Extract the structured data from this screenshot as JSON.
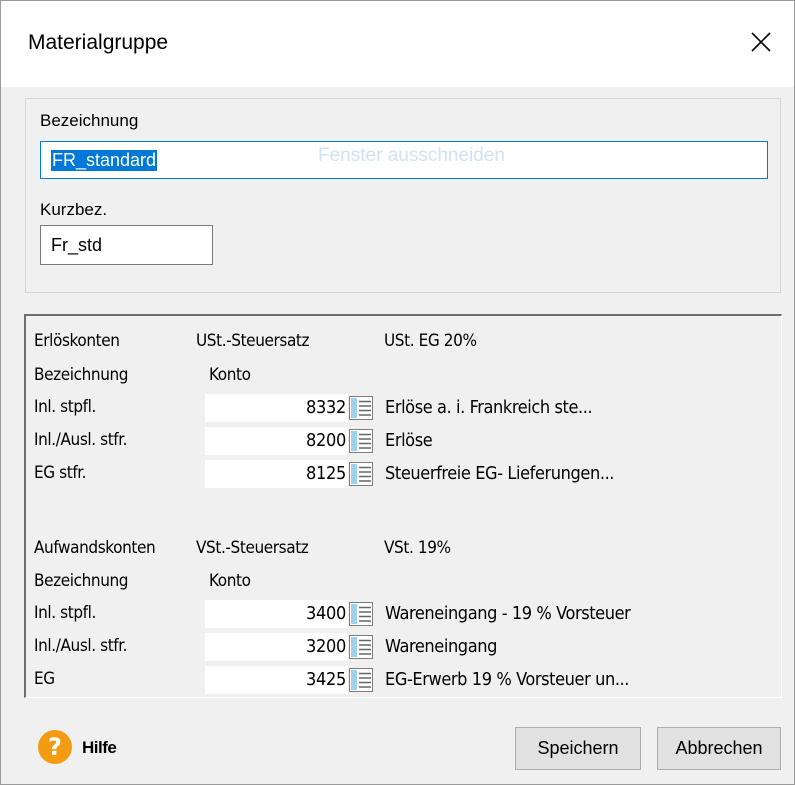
{
  "dialog": {
    "title": "Materialgruppe"
  },
  "fields": {
    "bezeichnung_label": "Bezeichnung",
    "bezeichnung_value": "FR_standard",
    "kurzbez_label": "Kurzbez.",
    "kurzbez_value": "Fr_std",
    "ghost_text": "Fenster ausschneiden"
  },
  "erloes": {
    "header": "Erlöskonten",
    "tax_label": "USt.-Steuersatz",
    "tax_value": "USt. EG 20%",
    "col_bezeichnung": "Bezeichnung",
    "col_konto": "Konto",
    "rows": [
      {
        "label": "Inl. stpfl.",
        "konto": "8332",
        "desc": "Erlöse a. i. Frankreich ste..."
      },
      {
        "label": "Inl./Ausl. stfr.",
        "konto": "8200",
        "desc": "Erlöse"
      },
      {
        "label": "EG stfr.",
        "konto": "8125",
        "desc": "Steuerfreie EG- Lieferungen..."
      }
    ]
  },
  "aufwand": {
    "header": "Aufwandskonten",
    "tax_label": "VSt.-Steuersatz",
    "tax_value": "VSt. 19%",
    "col_bezeichnung": "Bezeichnung",
    "col_konto": "Konto",
    "rows": [
      {
        "label": "Inl. stpfl.",
        "konto": "3400",
        "desc": "Wareneingang - 19 % Vorsteuer"
      },
      {
        "label": "Inl./Ausl. stfr.",
        "konto": "3200",
        "desc": "Wareneingang"
      },
      {
        "label": "EG",
        "konto": "3425",
        "desc": "EG-Erwerb 19 % Vorsteuer un..."
      }
    ]
  },
  "footer": {
    "help_symbol": "?",
    "help_label": "Hilfe",
    "save_label": "Speichern",
    "cancel_label": "Abbrechen"
  },
  "icons": {
    "close": "close-icon",
    "help": "help-icon",
    "picker": "table-picker-icon"
  },
  "colors": {
    "help_accent": "#f39c12",
    "selection": "#0078d7"
  }
}
